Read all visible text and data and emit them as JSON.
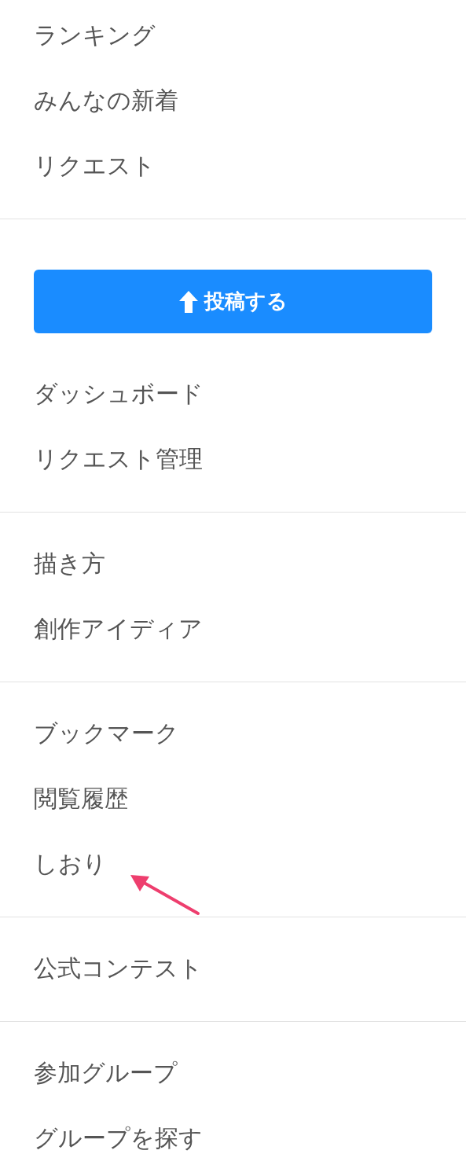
{
  "sections": [
    {
      "items": [
        {
          "kind": "link",
          "label": "ランキング"
        },
        {
          "kind": "link",
          "label": "みんなの新着"
        },
        {
          "kind": "link",
          "label": "リクエスト"
        }
      ]
    },
    {
      "items": [
        {
          "kind": "button",
          "label": "投稿する"
        },
        {
          "kind": "link",
          "label": "ダッシュボード"
        },
        {
          "kind": "link",
          "label": "リクエスト管理"
        }
      ]
    },
    {
      "items": [
        {
          "kind": "link",
          "label": "描き方"
        },
        {
          "kind": "link",
          "label": "創作アイディア"
        }
      ]
    },
    {
      "items": [
        {
          "kind": "link",
          "label": "ブックマーク"
        },
        {
          "kind": "link",
          "label": "閲覧履歴"
        },
        {
          "kind": "link",
          "label": "しおり",
          "annotated": true
        }
      ]
    },
    {
      "items": [
        {
          "kind": "link",
          "label": "公式コンテスト"
        }
      ]
    },
    {
      "items": [
        {
          "kind": "link",
          "label": "参加グループ"
        },
        {
          "kind": "link",
          "label": "グループを探す"
        }
      ]
    }
  ]
}
